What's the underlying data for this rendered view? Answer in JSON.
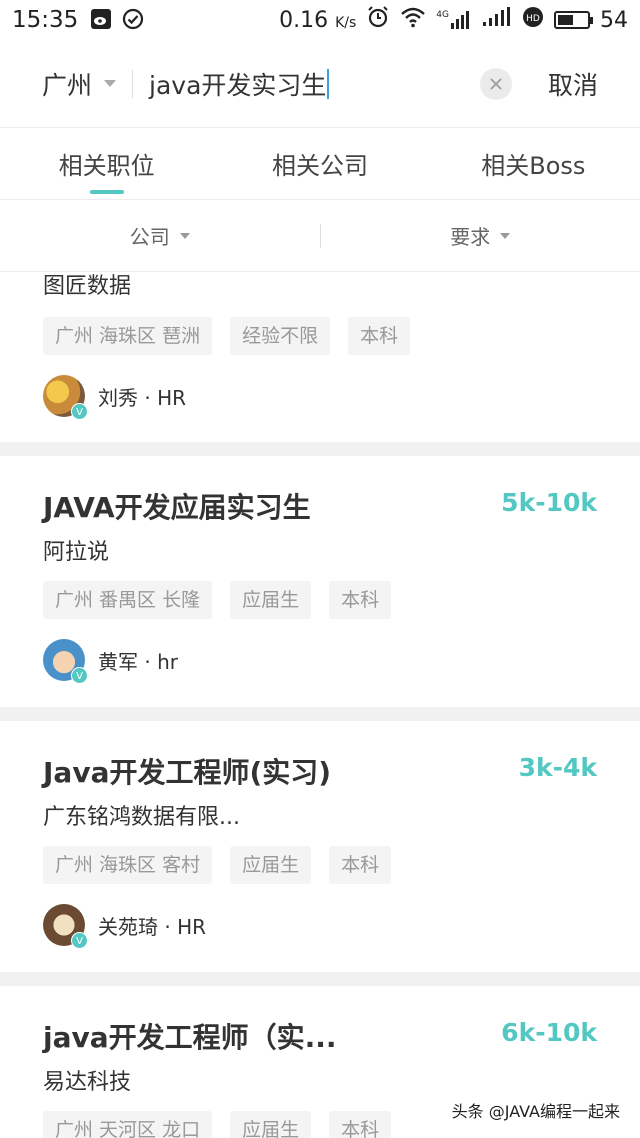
{
  "status_bar": {
    "time": "15:35",
    "speed": "0.16",
    "speed_unit": "K/s",
    "network": "4G",
    "battery": "54",
    "battery_level": 0.54
  },
  "search": {
    "city": "广州",
    "query": "java开发实习生",
    "clear_icon": "close-icon",
    "cancel_label": "取消"
  },
  "tabs": [
    {
      "label": "相关职位",
      "active": true
    },
    {
      "label": "相关公司",
      "active": false
    },
    {
      "label": "相关Boss",
      "active": false
    }
  ],
  "filters": [
    {
      "label": "公司"
    },
    {
      "label": "要求"
    }
  ],
  "jobs": [
    {
      "title": "",
      "salary": "",
      "company": "图匠数据",
      "tags": [
        "广州 海珠区 琶洲",
        "经验不限",
        "本科"
      ],
      "hr": "刘秀 · HR",
      "avatar_color": "#c9a04a"
    },
    {
      "title": "JAVA开发应届实习生",
      "salary": "5k-10k",
      "company": "阿拉说",
      "tags": [
        "广州 番禺区 长隆",
        "应届生",
        "本科"
      ],
      "hr": "黄军 · hr",
      "avatar_color": "#4a90c9"
    },
    {
      "title": "Java开发工程师(实习)",
      "salary": "3k-4k",
      "company": "广东铭鸿数据有限...",
      "tags": [
        "广州 海珠区 客村",
        "应届生",
        "本科"
      ],
      "hr": "关苑琦 · HR",
      "avatar_color": "#6b4a33"
    },
    {
      "title": "java开发工程师（实...",
      "salary": "6k-10k",
      "company": "易达科技",
      "tags": [
        "广州 天河区 龙口",
        "应届生",
        "本科"
      ],
      "hr": "",
      "avatar_color": "#888888"
    }
  ],
  "verified_badge": "V",
  "watermark": "头条 @JAVA编程一起来",
  "colors": {
    "accent": "#53c7c2"
  }
}
